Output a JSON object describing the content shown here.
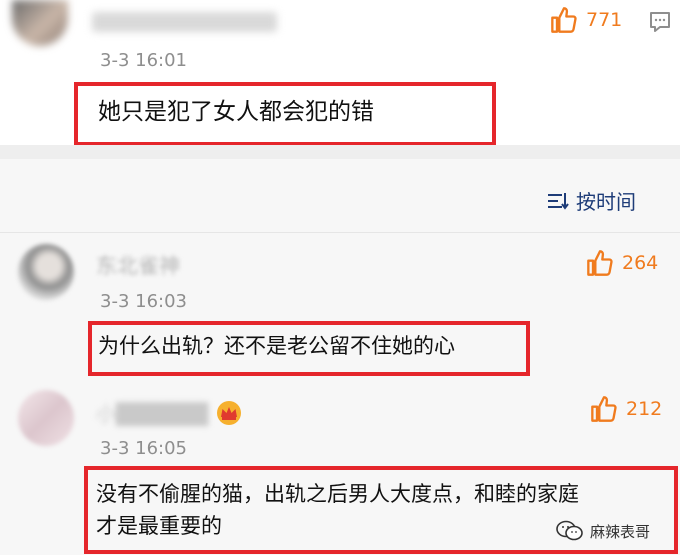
{
  "comments": [
    {
      "username": "██████████",
      "date": "3-3 16:01",
      "likes": "771",
      "text": "她只是犯了女人都会犯的错"
    },
    {
      "username": "东北雀神",
      "date": "3-3 16:03",
      "likes": "264",
      "text": "为什么出轨？还不是老公留不住她的心"
    },
    {
      "username": "小██████",
      "date": "3-3 16:05",
      "likes": "212",
      "text_line1": "没有不偷腥的猫，出轨之后男人大度点，和睦的家庭",
      "text_line2": "才是最重要的"
    }
  ],
  "sort_label": "按时间",
  "watermark": "麻辣表哥",
  "icons": {
    "like": "thumbs-up-icon",
    "reply": "comment-bubble-icon",
    "sort": "sort-lines-icon",
    "vip": "crown-badge-icon",
    "watermark": "wechat-logo-icon"
  },
  "colors": {
    "highlight_box": "#e5262b",
    "like": "#f07b1e",
    "sort_link": "#1e3c78",
    "timestamp": "#8e8e8e"
  }
}
